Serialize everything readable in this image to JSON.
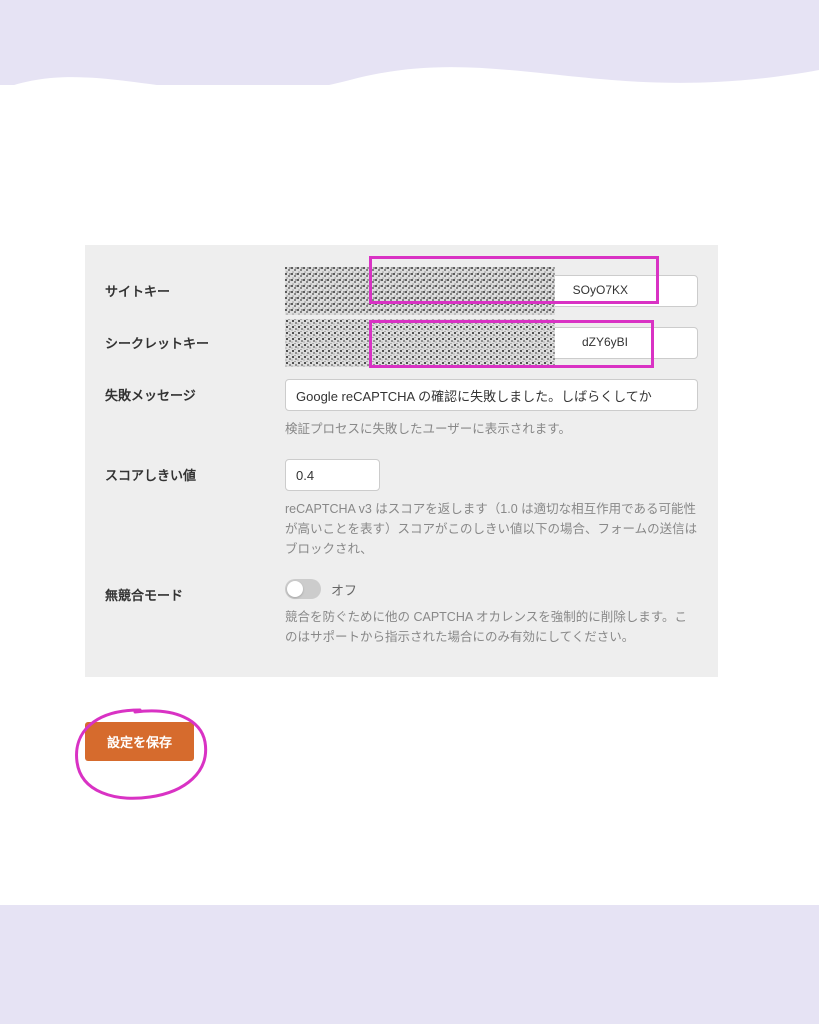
{
  "form": {
    "siteKey": {
      "label": "サイトキー",
      "visibleSuffix": "SOyO7KX"
    },
    "secretKey": {
      "label": "シークレットキー",
      "visibleSuffix": "dZY6yBI"
    },
    "failureMessage": {
      "label": "失敗メッセージ",
      "value": "Google reCAPTCHA の確認に失敗しました。しばらくしてか",
      "help": "検証プロセスに失敗したユーザーに表示されます。"
    },
    "scoreThreshold": {
      "label": "スコアしきい値",
      "value": "0.4",
      "help": "reCAPTCHA v3 はスコアを返します（1.0 は適切な相互作用である可能性が高いことを表す）スコアがこのしきい値以下の場合、フォームの送信はブロックされ、"
    },
    "noConflictMode": {
      "label": "無競合モード",
      "state": "オフ",
      "help": "競合を防ぐために他の CAPTCHA オカレンスを強制的に削除します。このはサポートから指示された場合にのみ有効にしてください。"
    }
  },
  "actions": {
    "save": "設定を保存"
  }
}
